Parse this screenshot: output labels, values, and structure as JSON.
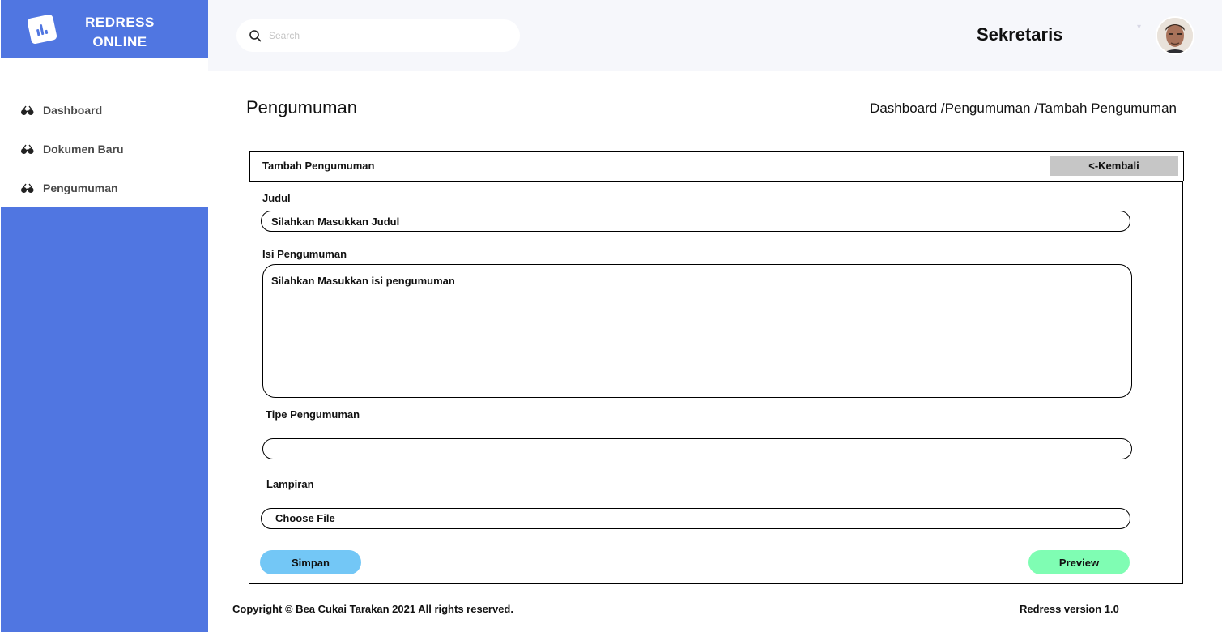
{
  "brand": {
    "line1": "REDRESS",
    "line2": "ONLINE",
    "logo_icon": "chart-bars-icon"
  },
  "colors": {
    "sidebar": "#5076e1",
    "topbar": "#f6f7fb",
    "back_button": "#c6c6c6",
    "simpan": "#73c7f6",
    "preview": "#7ffdb3"
  },
  "sidebar": {
    "items": [
      {
        "label": "Dashboard",
        "icon": "glasses-icon"
      },
      {
        "label": "Dokumen Baru",
        "icon": "glasses-icon"
      },
      {
        "label": "Pengumuman",
        "icon": "glasses-icon"
      }
    ]
  },
  "topbar": {
    "search": {
      "placeholder": "Search",
      "value": ""
    },
    "user_role": "Sekretaris"
  },
  "page": {
    "title": "Pengumuman",
    "breadcrumb": "Dashboard /Pengumuman /Tambah Pengumuman"
  },
  "card": {
    "title": "Tambah Pengumuman",
    "back_label": "<-Kembali"
  },
  "form": {
    "judul_label": "Judul",
    "judul_value": "Silahkan Masukkan Judul",
    "isi_label": "Isi Pengumuman",
    "isi_value": "Silahkan Masukkan isi pengumuman",
    "tipe_label": "Tipe Pengumuman",
    "tipe_value": "",
    "lampiran_label": "Lampiran",
    "file_label": "Choose File",
    "simpan_label": "Simpan",
    "preview_label": "Preview"
  },
  "footer": {
    "copyright": "Copyright © Bea Cukai Tarakan 2021 All rights reserved.",
    "version": "Redress version 1.0"
  }
}
